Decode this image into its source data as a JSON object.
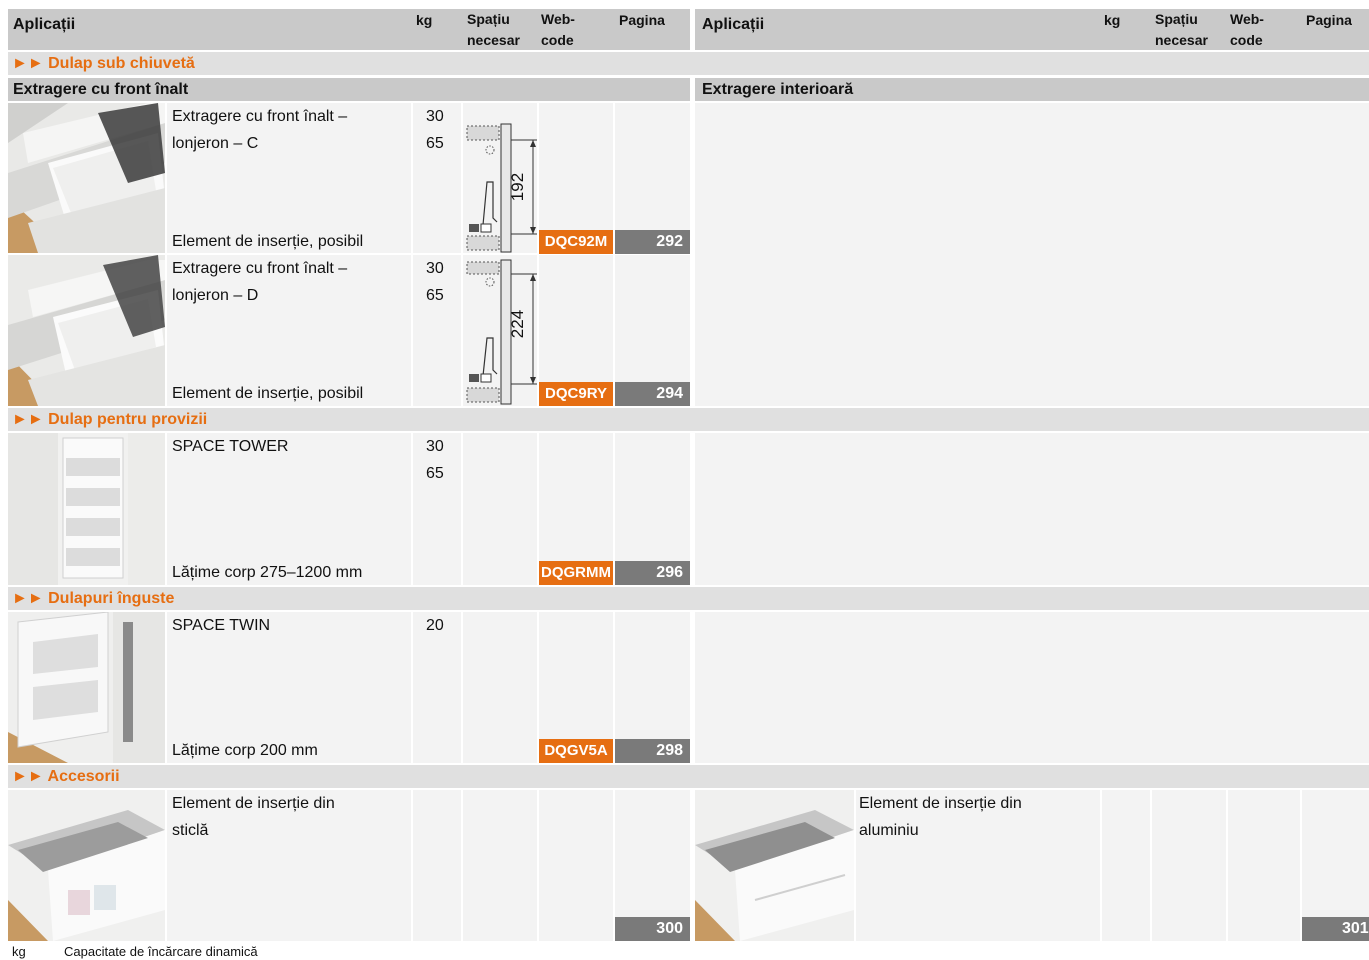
{
  "header": {
    "applications": "Aplicații",
    "kg": "kg",
    "space_line1": "Spațiu",
    "space_line2": "necesar",
    "webcode_line1": "Web-",
    "webcode_line2": "code",
    "page": "Pagina"
  },
  "sections": {
    "sink": "►► Dulap sub chiuvetă",
    "pantry": "►► Dulap pentru provizii",
    "narrow": "►► Dulapuri înguste",
    "accessories": "►► Accesorii"
  },
  "subsections": {
    "high_front": "Extragere cu front înalt",
    "inner": "Extragere interioară"
  },
  "rows": [
    {
      "line1": "Extragere cu front înalt –",
      "line2": "lonjeron – C",
      "kg1": "30",
      "kg2": "65",
      "bottom": "Element de inserție, posibil",
      "dimension": "192",
      "webcode": "DQC92M",
      "page": "292"
    },
    {
      "line1": "Extragere cu front înalt –",
      "line2": "lonjeron – D",
      "kg1": "30",
      "kg2": "65",
      "bottom": "Element de inserție, posibil",
      "dimension": "224",
      "webcode": "DQC9RY",
      "page": "294"
    },
    {
      "line1": "SPACE TOWER",
      "kg1": "30",
      "kg2": "65",
      "bottom": "Lățime corp 275–1200 mm",
      "webcode": "DQGRMM",
      "page": "296"
    },
    {
      "line1": "SPACE TWIN",
      "kg1": "20",
      "bottom": "Lățime corp 200 mm",
      "webcode": "DQGV5A",
      "page": "298"
    }
  ],
  "accessories": [
    {
      "line1": "Element de inserție din",
      "line2": "sticlă",
      "page": "300"
    },
    {
      "line1": "Element de inserție din",
      "line2": "aluminiu",
      "page": "301"
    }
  ],
  "footer": {
    "abbr": "kg",
    "text": "Capacitate de încărcare dinamică"
  },
  "colors": {
    "accent": "#e66e12",
    "page_badge": "#7a7a7a",
    "header_bg": "#c9c9c9",
    "bar_bg": "#e0e0e0",
    "cell_bg": "#f3f3f3"
  }
}
